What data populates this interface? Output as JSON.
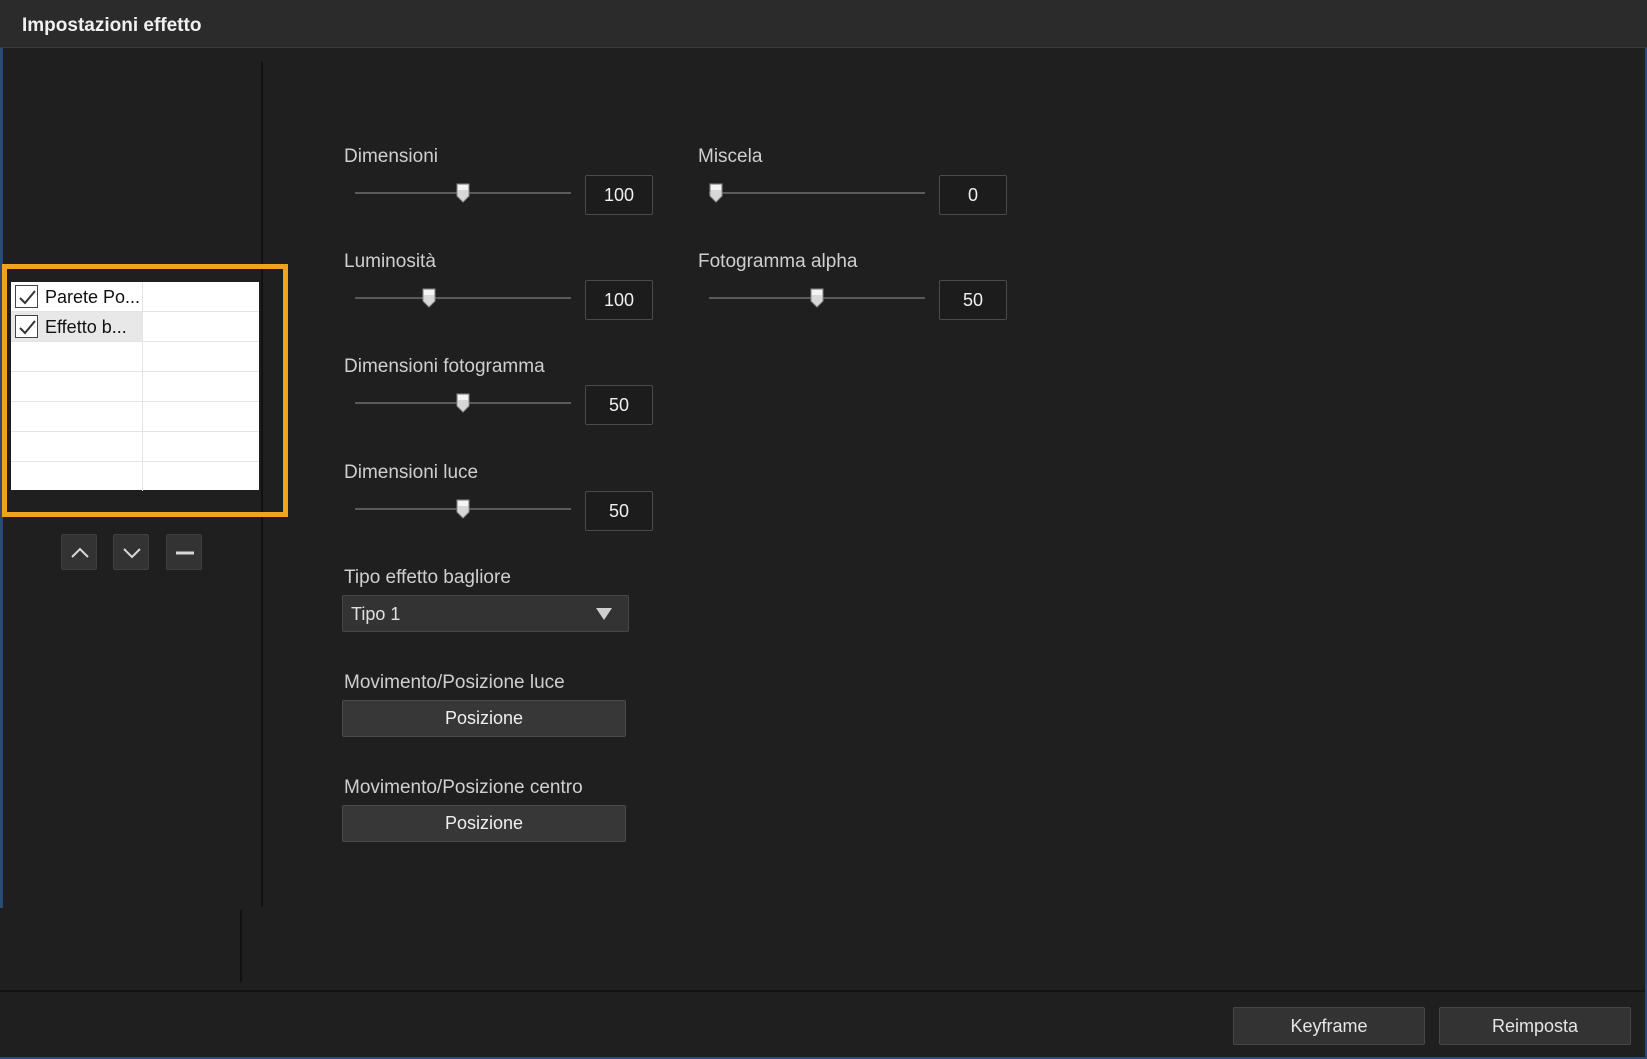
{
  "window": {
    "title": "Impostazioni effetto"
  },
  "layers": [
    {
      "label": "Parete Po...",
      "checked": true,
      "selected": false
    },
    {
      "label": "Effetto b...",
      "checked": true,
      "selected": true
    }
  ],
  "layer_buttons": {
    "up_icon": "chevron-up-icon",
    "down_icon": "chevron-down-icon",
    "remove_icon": "minus-icon"
  },
  "params": {
    "dimensioni": {
      "label": "Dimensioni",
      "value": "100",
      "level": 0.5
    },
    "miscela": {
      "label": "Miscela",
      "value": "0",
      "level": 0.0
    },
    "luminosita": {
      "label": "Luminosità",
      "value": "100",
      "level": 0.33
    },
    "fotogramma_alpha": {
      "label": "Fotogramma alpha",
      "value": "50",
      "level": 0.5
    },
    "dimensioni_fotogramma": {
      "label": "Dimensioni fotogramma",
      "value": "50",
      "level": 0.5
    },
    "dimensioni_luce": {
      "label": "Dimensioni luce",
      "value": "50",
      "level": 0.5
    }
  },
  "glare_type": {
    "label": "Tipo effetto bagliore",
    "value": "Tipo 1"
  },
  "light_motion": {
    "label": "Movimento/Posizione luce",
    "button": "Posizione"
  },
  "center_motion": {
    "label": "Movimento/Posizione centro",
    "button": "Posizione"
  },
  "footer": {
    "keyframe": "Keyframe",
    "reset": "Reimposta"
  },
  "colors": {
    "highlight": "#f0a41e",
    "frame": "#2a4a7a"
  }
}
